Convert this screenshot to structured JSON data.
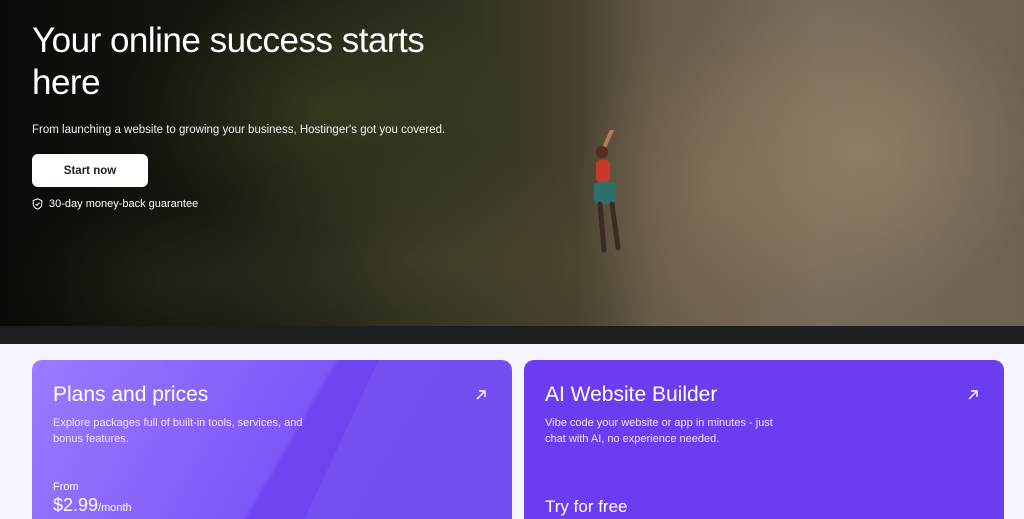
{
  "hero": {
    "title": "Your online success starts here",
    "subtitle": "From launching a website to growing your business, Hostinger's got you covered.",
    "cta_label": "Start now",
    "guarantee_text": "30-day money-back guarantee"
  },
  "cards": {
    "plans": {
      "title": "Plans and prices",
      "description": "Explore packages full of built-in tools, services, and bonus features.",
      "from_label": "From",
      "price": "$2.99",
      "price_unit": "/month"
    },
    "ai_builder": {
      "title": "AI Website Builder",
      "description": "Vibe code your website or app in minutes - just chat with AI, no experience needed.",
      "cta_label": "Try for free"
    }
  },
  "colors": {
    "card_purple": "#6b3cf0",
    "button_bg": "#ffffff",
    "page_bg": "#f4f5ff"
  },
  "icons": [
    "shield-check-icon",
    "arrow-up-right-icon"
  ]
}
